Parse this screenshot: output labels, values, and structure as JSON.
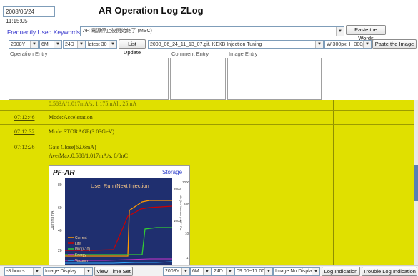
{
  "header": {
    "datetime": "2008/06/24 11:15:05",
    "title": "AR Operation Log ZLog"
  },
  "keywords": {
    "label": "Frequently Used Keywords",
    "selected": "AR 電源停止後開始終了 (MSC)",
    "paste_button": "Paste the Words"
  },
  "toolbar": {
    "year": "2008Y",
    "month": "6M",
    "day": "24D",
    "latest": "latest 30",
    "list_update": "List Update",
    "image_file": "2008_06_24_11_13_07.gif, KEKB Injection Tuning",
    "image_size": "W 300px, H 300px",
    "paste_image": "Paste the Image"
  },
  "entries": {
    "operation": "Operation Entry",
    "comment": "Comment Entry",
    "image": "Image Entry"
  },
  "log": {
    "partial_text": "0.583A/1.017mA/s, 1.175mAh, 25mA",
    "rows": [
      {
        "time": "07:12:46",
        "message": "Mode:Acceleration"
      },
      {
        "time": "07:12:32",
        "message": "Mode:STORAGE(3.03GeV)"
      },
      {
        "time": "07:12:26",
        "message": "Gate Close(62.6mA)",
        "message2": "Ave/Max:0.588/1.017mA/s, 0/0nC"
      }
    ]
  },
  "plot": {
    "title": "PF-AR",
    "subtitle": "Storage",
    "banner": "User Run (Next Injection",
    "ylabel_left": "Current (mA)",
    "ylabel_right": "Life (h) / Vacuum (×10⁻⁷ Pa)",
    "left_ticks": [
      "80",
      "60",
      "40",
      "20"
    ],
    "right_ticks_a": [
      "2000",
      "1000"
    ],
    "right_ticks_b": [
      "1000",
      "100",
      "10",
      "1"
    ],
    "legend": [
      "Current",
      "Life",
      "I/W (Λ10)",
      "Energy",
      "Vacuum"
    ],
    "colors": {
      "current": "#ff9900",
      "life": "#cc0000",
      "lw": "#33cc33",
      "energy": "#cc33cc",
      "vacuum": "#33aaff"
    }
  },
  "footer": {
    "hours": "-8 hours",
    "image_display": "Image Display",
    "view_time_set": "View Time Set",
    "year": "2008Y",
    "month": "6M",
    "day": "24D",
    "time_range": "09:00~17:00",
    "image_no_display": "Image No Display",
    "log_indication": "Log Indication",
    "trouble_log": "Trouble Log Indication"
  }
}
